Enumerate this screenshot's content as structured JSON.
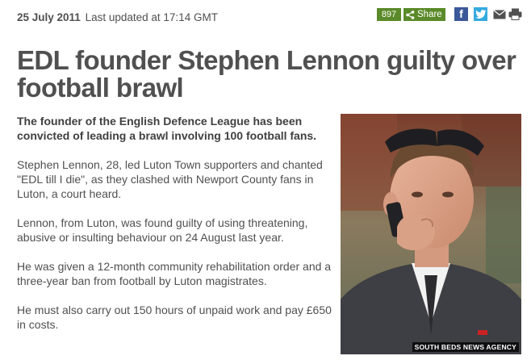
{
  "dateline": {
    "date": "25 July 2011",
    "updated": "Last updated at 17:14 GMT"
  },
  "share": {
    "count": "897",
    "label": "Share"
  },
  "social": {
    "icons": [
      "facebook-icon",
      "twitter-icon",
      "email-icon",
      "print-icon"
    ],
    "colors": {
      "facebook": "#3b5998",
      "twitter": "#35aadf",
      "share": "#5a8a29"
    }
  },
  "article": {
    "headline": "EDL founder Stephen Lennon guilty over football brawl",
    "intro": "The founder of the English Defence League has been convicted of leading a brawl involving 100 football fans.",
    "paragraphs": [
      "Stephen Lennon, 28, led Luton Town supporters and chanted \"EDL till I die\", as they clashed with Newport County fans in Luton, a court heard.",
      "Lennon, from Luton, was found guilty of using threatening, abusive or insulting behaviour on 24 August last year.",
      "He was given a 12-month community rehabilitation order and a three-year ban from football by Luton magistrates.",
      "He must also carry out 150 hours of unpaid work and pay £650 in costs."
    ]
  },
  "photo": {
    "credit": "SOUTH BEDS NEWS AGENCY"
  }
}
